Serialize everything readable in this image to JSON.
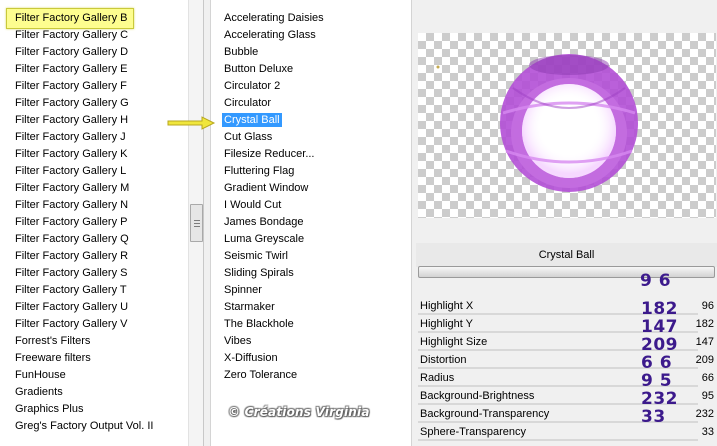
{
  "categories": [
    "Filter Factory Gallery B",
    "Filter Factory Gallery C",
    "Filter Factory Gallery D",
    "Filter Factory Gallery E",
    "Filter Factory Gallery F",
    "Filter Factory Gallery G",
    "Filter Factory Gallery H",
    "Filter Factory Gallery J",
    "Filter Factory Gallery K",
    "Filter Factory Gallery L",
    "Filter Factory Gallery M",
    "Filter Factory Gallery N",
    "Filter Factory Gallery P",
    "Filter Factory Gallery Q",
    "Filter Factory Gallery R",
    "Filter Factory Gallery S",
    "Filter Factory Gallery T",
    "Filter Factory Gallery U",
    "Filter Factory Gallery V",
    "Forrest's Filters",
    "Freeware filters",
    "FunHouse",
    "Gradients",
    "Graphics Plus",
    "Greg's Factory Output Vol. II"
  ],
  "selected_category": "Filter Factory Gallery B",
  "filters": [
    "Accelerating Daisies",
    "Accelerating Glass",
    "Bubble",
    "Button Deluxe",
    "Circulator 2",
    "Circulator",
    "Crystal Ball",
    "Cut Glass",
    "Filesize Reducer...",
    "Fluttering Flag",
    "Gradient Window",
    "I Would Cut",
    "James Bondage",
    "Luma Greyscale",
    "Seismic Twirl",
    "Sliding Spirals",
    "Spinner",
    "Starmaker",
    "The Blackhole",
    "Vibes",
    "X-Diffusion",
    "Zero Tolerance"
  ],
  "selected_filter": "Crystal Ball",
  "filter_title": "Crystal Ball",
  "watermark": "© Créations Virginia",
  "top_big_number": "9 6",
  "params": [
    {
      "label": "Highlight X",
      "value": "96",
      "big": "182"
    },
    {
      "label": "Highlight Y",
      "value": "182",
      "big": "147"
    },
    {
      "label": "Highlight Size",
      "value": "147",
      "big": "209"
    },
    {
      "label": "Distortion",
      "value": "209",
      "big": "6 6"
    },
    {
      "label": "Radius",
      "value": "66",
      "big": "9 5"
    },
    {
      "label": "Background-Brightness",
      "value": "95",
      "big": "232"
    },
    {
      "label": "Background-Transparency",
      "value": "232",
      "big": "33"
    },
    {
      "label": "Sphere-Transparency",
      "value": "33",
      "big": ""
    }
  ],
  "colors": {
    "selection_highlight": "#fdfd8f",
    "list_selection": "#3399ff",
    "big_number": "#3c1a8c",
    "sphere": "#b24fd6",
    "arrow": "#f0e63c"
  }
}
